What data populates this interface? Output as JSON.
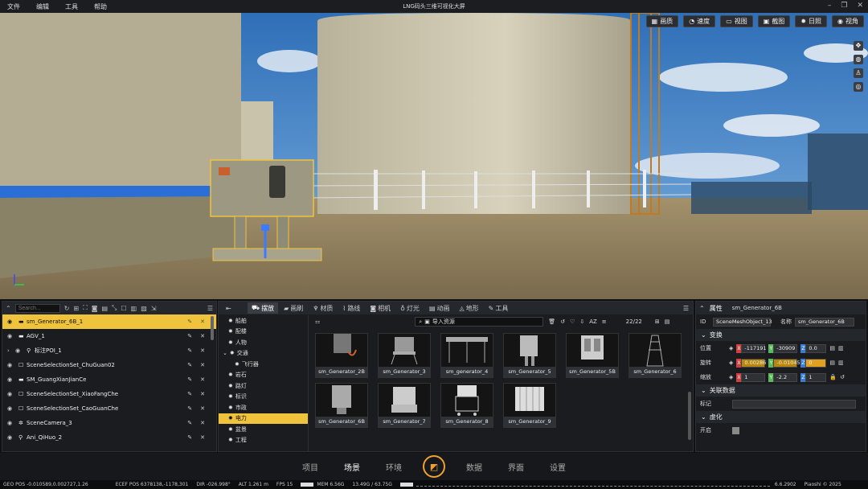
{
  "menu": [
    "文件",
    "编辑",
    "工具",
    "帮助"
  ],
  "app_title": "LNG码头三维可视化大屏",
  "toolbar": [
    {
      "icon": "quality-icon",
      "label": "画质"
    },
    {
      "icon": "speed-icon",
      "label": "速度"
    },
    {
      "icon": "view-icon",
      "label": "视图"
    },
    {
      "icon": "screenshot-icon",
      "label": "截图"
    },
    {
      "icon": "sun-icon",
      "label": "日照"
    },
    {
      "icon": "eye-icon",
      "label": "视角"
    }
  ],
  "outliner": {
    "search_placeholder": "Search...",
    "rows": [
      {
        "label": "sm_Generator_6B_1",
        "selected": true
      },
      {
        "label": "AGV_1"
      },
      {
        "label": "标注POI_1",
        "expand": true
      },
      {
        "label": "SceneSelectionSet_ChuGuan02"
      },
      {
        "label": "SM_GuangXianJianCe"
      },
      {
        "label": "SceneSelectionSet_XiaoFangChe"
      },
      {
        "label": "SceneSelectionSet_CaoGuanChe"
      },
      {
        "label": "SceneCamera_3"
      },
      {
        "label": "Ani_QiHuo_2"
      }
    ]
  },
  "asset_tabs": [
    "摆放",
    "画刷",
    "材质",
    "路线",
    "相机",
    "灯光",
    "动画",
    "地形",
    "工具"
  ],
  "categories": [
    {
      "label": "船舶"
    },
    {
      "label": "配楼"
    },
    {
      "label": "人物"
    },
    {
      "label": "交通",
      "expand": true
    },
    {
      "label": "飞行器",
      "sub": true
    },
    {
      "label": "岩石"
    },
    {
      "label": "路灯"
    },
    {
      "label": "标识"
    },
    {
      "label": "市政"
    },
    {
      "label": "电力",
      "selected": true
    },
    {
      "label": "盆景"
    },
    {
      "label": "工程"
    }
  ],
  "asset_search": "导入资源",
  "asset_count": "22/22",
  "assets": [
    "sm_Generator_2B",
    "sm_Generator_3",
    "sm_generator_4",
    "sm_Generator_5",
    "sm_Generator_5B",
    "sm_Generator_6",
    "sm_Generator_6B",
    "sm_Generator_7",
    "sm_Generator_8",
    "sm_Generator_9"
  ],
  "properties": {
    "header": "属性",
    "object_name": "sm_Generator_6B",
    "id_label": "ID",
    "id_value": "SceneMeshObject_13",
    "name_label": "名称",
    "name_value": "sm_Generator_6B",
    "transform_header": "变换",
    "position_label": "位置",
    "position": [
      "-117191",
      "-30909",
      "0.0"
    ],
    "rotation_label": "旋转",
    "rotation": [
      "0.00286",
      "-0.010453",
      "0"
    ],
    "scale_label": "缩放",
    "scale": [
      "1",
      "-2.2",
      "1"
    ],
    "related_header": "关联数据",
    "tag_label": "标记",
    "virtual_header": "虚化",
    "enable_label": "开启"
  },
  "nav": [
    "项目",
    "场景",
    "环境",
    "数据",
    "界面",
    "设置"
  ],
  "nav_active": "场景",
  "status": [
    "GEO POS -0.010589,0.002727,1.26",
    "ECEF POS 6378138,-1178,301",
    "DIR -026.998°",
    "ALT 1.261 m",
    "FPS 15",
    "MEM 6.56G",
    "13.49G / 63.75G",
    "6.6.2902",
    "Piaoshi © 2025"
  ]
}
